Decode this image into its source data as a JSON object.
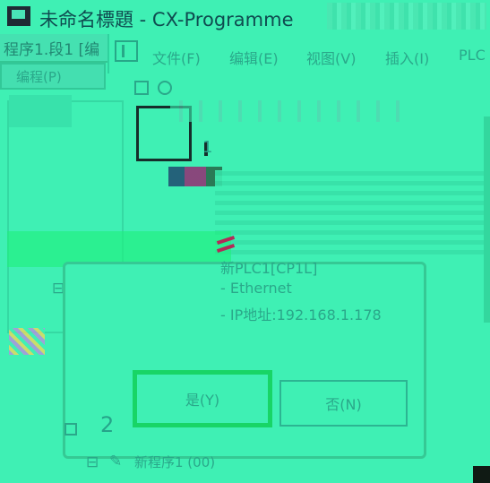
{
  "window": {
    "title": "未命名標題 - CX-Programme"
  },
  "subwindow": {
    "tab_label": "程序1.段1 [编"
  },
  "menu": {
    "items": [
      "文件(F)",
      "编辑(E)",
      "视图(V)",
      "插入(I)",
      "PLC"
    ]
  },
  "left_panel": {
    "tab_label": "编程(P)"
  },
  "tree": {
    "node_partial": "新"
  },
  "dialog": {
    "info_lines": [
      "新PLC1[CP1L]",
      "- Ethernet",
      "- IP地址:192.168.1.178"
    ],
    "yes_label": "是(Y)",
    "no_label": "否(N)"
  },
  "annotations": {
    "step1": "1",
    "step2": "2"
  },
  "bottom_tree": {
    "program_node": "新程序1 (00)"
  },
  "colors": {
    "background": "#3ff0b4",
    "text": "#2aa88a",
    "yes_highlight": "#18d566",
    "title_text": "#0f4c50"
  }
}
